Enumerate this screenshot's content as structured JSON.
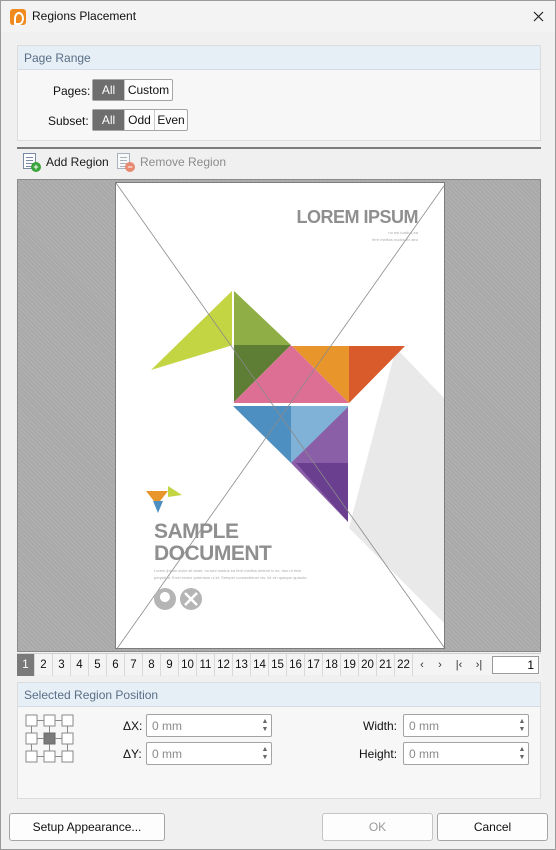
{
  "window": {
    "title": "Regions Placement"
  },
  "page_range": {
    "header": "Page Range",
    "pages_label": "Pages:",
    "pages_options": [
      "All",
      "Custom"
    ],
    "pages_selected": "All",
    "subset_label": "Subset:",
    "subset_options": [
      "All",
      "Odd",
      "Even"
    ],
    "subset_selected": "All"
  },
  "toolbar": {
    "add_label": "Add Region",
    "remove_label": "Remove Region"
  },
  "document": {
    "title": "LOREM IPSUM",
    "subtitle_lines": [
      "no est tuddus ea",
      "ferri melitos nudos ex aeu"
    ],
    "heading_1": "SAMPLE",
    "heading_2": "DOCUMENT",
    "body_lines": [
      "Lorem ipsum dolor sit amet, no sed tuddus ea ferri melitos delenit ix no, duo ut erat",
      "perpetua. Errel erclue potentum ui et. Semper consectetuer vis, lid vin quaque quaudo"
    ],
    "colors": {
      "lime": "#c3d543",
      "green": "#8fae45",
      "dkgreen": "#5e7d35",
      "orange": "#e8962c",
      "red": "#d95a2b",
      "pink": "#dd6f95",
      "blue": "#4e8fc2",
      "ltblue": "#7fb2d6",
      "purple": "#8a5fa8",
      "dkpurple": "#6a3f8f",
      "grey": "#8f8f8f"
    }
  },
  "pager": {
    "pages": [
      "1",
      "2",
      "3",
      "4",
      "5",
      "6",
      "7",
      "8",
      "9",
      "10",
      "11",
      "12",
      "13",
      "14",
      "15",
      "16",
      "17",
      "18",
      "19",
      "20",
      "21",
      "22"
    ],
    "current": "1",
    "input_value": "1"
  },
  "region_position": {
    "header": "Selected Region Position",
    "dx_label": "ΔX:",
    "dx_value": "0 mm",
    "dy_label": "ΔY:",
    "dy_value": "0 mm",
    "width_label": "Width:",
    "width_value": "0 mm",
    "height_label": "Height:",
    "height_value": "0 mm"
  },
  "footer": {
    "setup_label": "Setup Appearance...",
    "ok_label": "OK",
    "cancel_label": "Cancel"
  }
}
